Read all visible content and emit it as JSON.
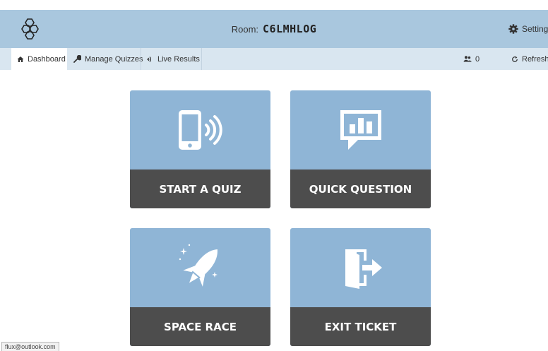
{
  "header": {
    "room_label": "Room:",
    "room_code": "C6LMHLOG",
    "settings_label": "Setting"
  },
  "nav": {
    "tabs": [
      {
        "label": "Dashboard",
        "icon": "home-icon",
        "active": true
      },
      {
        "label": "Manage Quizzes",
        "icon": "wrench-icon",
        "active": false
      },
      {
        "label": "Live Results",
        "icon": "signal-icon",
        "active": false
      }
    ],
    "student_count": "0",
    "refresh_label": "Refresh"
  },
  "tiles": [
    {
      "label": "START A QUIZ",
      "icon": "phone-signal-icon"
    },
    {
      "label": "QUICK QUESTION",
      "icon": "chat-chart-icon"
    },
    {
      "label": "SPACE RACE",
      "icon": "rocket-icon"
    },
    {
      "label": "EXIT TICKET",
      "icon": "exit-door-icon"
    }
  ],
  "status_url": "flux@outlook.com",
  "colors": {
    "header": "#a9c7de",
    "navbar": "#d9e6f0",
    "tile": "#8fb5d6",
    "tile_label": "#4d4d4d"
  }
}
